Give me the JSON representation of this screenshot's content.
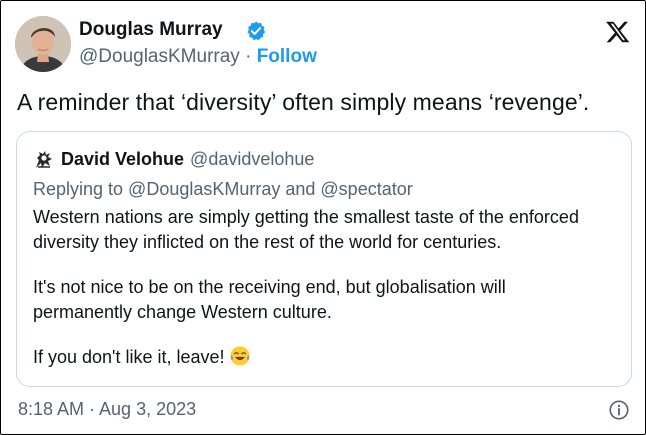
{
  "tweet": {
    "author": {
      "name": "Douglas Murray",
      "handle": "@DouglasKMurray",
      "separator": "·",
      "follow_label": "Follow"
    },
    "text": "A reminder that ‘diversity’ often simply means ‘revenge’.",
    "timestamp": "8:18 AM · Aug 3, 2023"
  },
  "quoted_tweet": {
    "author": {
      "name": "David Velohue",
      "handle": "@davidvelohue"
    },
    "reply_line": "Replying to @DouglasKMurray and @spectator",
    "paragraphs": [
      "Western nations are simply getting the smallest taste of the enforced",
      "diversity they inflicted on the rest of the world for centuries.",
      "It's not nice to be on the receiving end, but globalisation will",
      "permanently change Western culture.",
      "If you don't like it, leave!"
    ]
  },
  "icons": {
    "verified": "verified-badge-icon",
    "logo": "x-logo-icon",
    "emoji": "laughing-tears-emoji-icon",
    "info": "info-icon"
  },
  "colors": {
    "accent": "#1d9bf0",
    "text": "#0f1419",
    "secondary_text": "#536471",
    "border": "#cfd9de"
  }
}
